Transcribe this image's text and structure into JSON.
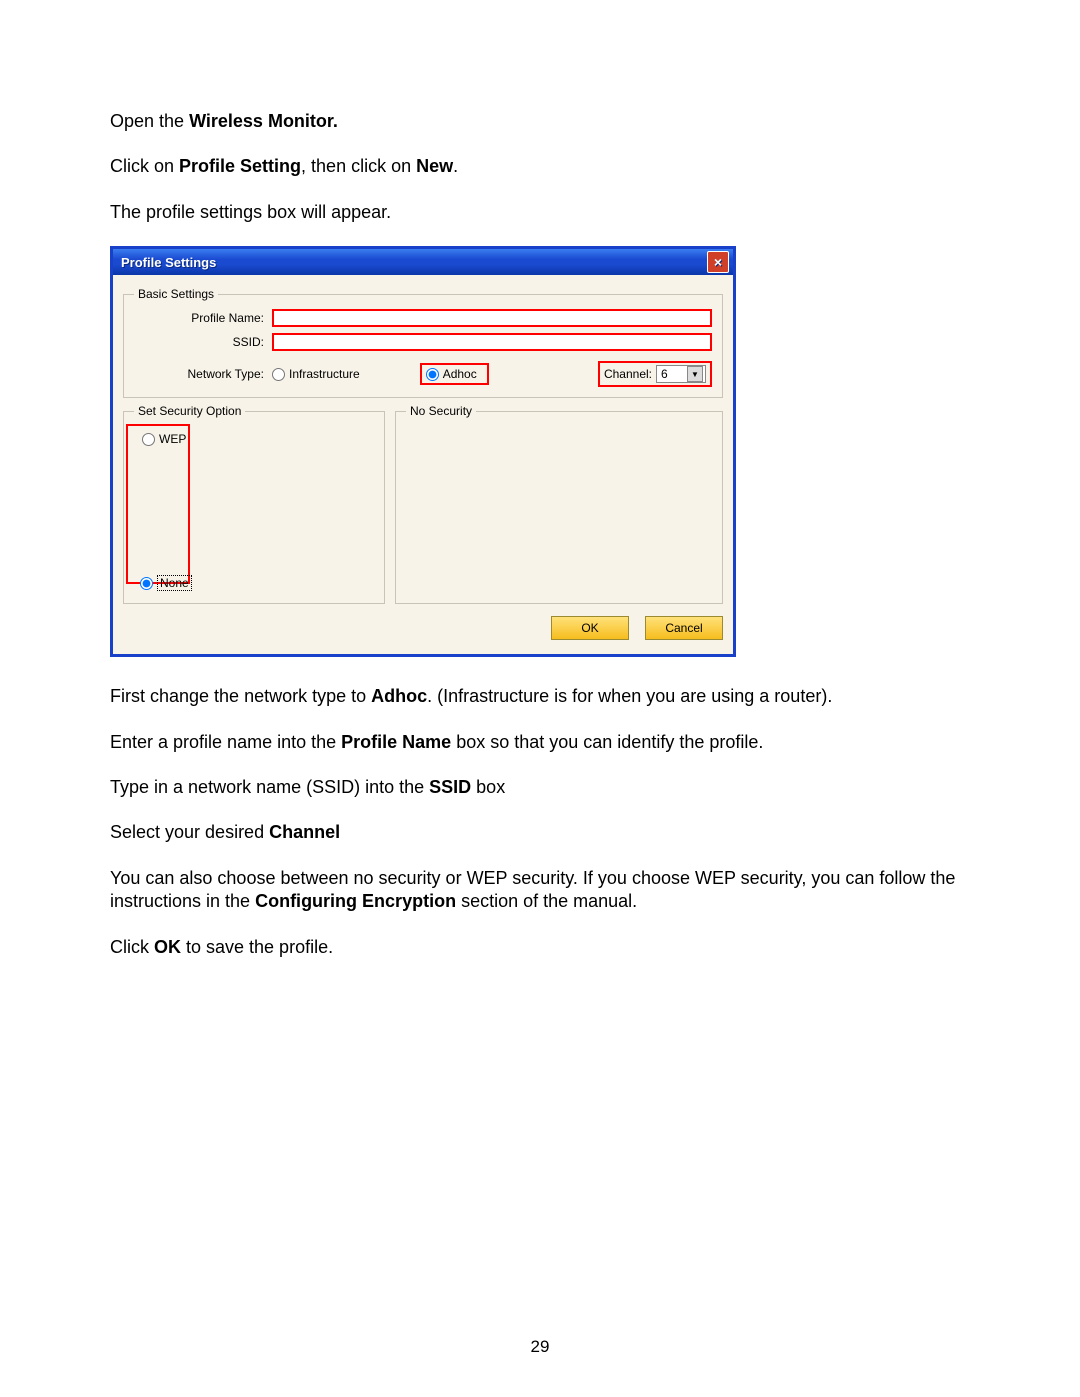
{
  "doc": {
    "p1_a": "Open the ",
    "p1_b": "Wireless Monitor.",
    "p2_a": "Click on ",
    "p2_b": "Profile Setting",
    "p2_c": ", then click on ",
    "p2_d": "New",
    "p2_e": ".",
    "p3": "The profile settings box will appear.",
    "p4_a": "First change the network type to ",
    "p4_b": "Adhoc",
    "p4_c": ".  (Infrastructure is for when you are using a router).",
    "p5_a": "Enter a profile name into the ",
    "p5_b": "Profile Name",
    "p5_c": " box so that you can identify the profile.",
    "p6_a": "Type in a network name (SSID) into the ",
    "p6_b": "SSID",
    "p6_c": " box",
    "p7_a": "Select your desired ",
    "p7_b": "Channel",
    "p8_a": "You can also choose between no security or WEP security.  If you choose WEP security, you can follow the instructions in the ",
    "p8_b": "Configuring Encryption",
    "p8_c": " section of the manual.",
    "p9_a": "Click ",
    "p9_b": "OK",
    "p9_c": " to save the profile.",
    "page_number": "29"
  },
  "dialog": {
    "title": "Profile Settings",
    "close": "×",
    "basic": {
      "legend": "Basic Settings",
      "profile_name_label": "Profile Name:",
      "profile_name_value": "",
      "ssid_label": "SSID:",
      "ssid_value": "",
      "network_type_label": "Network Type:",
      "infrastructure": "Infrastructure",
      "adhoc": "Adhoc",
      "channel_label": "Channel:",
      "channel_value": "6"
    },
    "security": {
      "legend": "Set Security Option",
      "wep": "WEP",
      "none": "None"
    },
    "no_security": {
      "legend": "No Security"
    },
    "buttons": {
      "ok": "OK",
      "cancel": "Cancel"
    }
  }
}
